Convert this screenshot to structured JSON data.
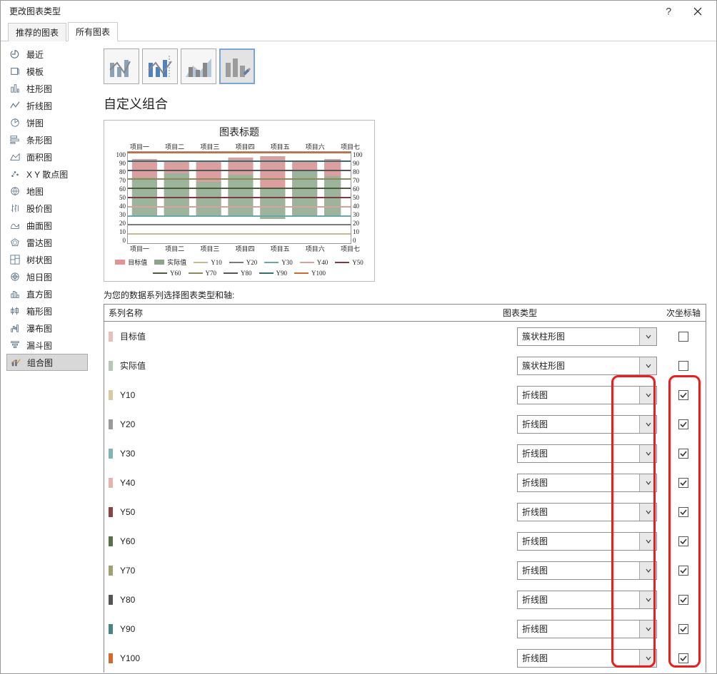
{
  "dialog": {
    "title": "更改图表类型"
  },
  "tabs": {
    "recommended": "推荐的图表",
    "all": "所有图表"
  },
  "categories": [
    {
      "icon": "recent",
      "label": "最近"
    },
    {
      "icon": "template",
      "label": "模板"
    },
    {
      "icon": "column",
      "label": "柱形图"
    },
    {
      "icon": "line",
      "label": "折线图"
    },
    {
      "icon": "pie",
      "label": "饼图"
    },
    {
      "icon": "bar",
      "label": "条形图"
    },
    {
      "icon": "area",
      "label": "面积图"
    },
    {
      "icon": "scatter",
      "label": "X Y 散点图"
    },
    {
      "icon": "map",
      "label": "地图"
    },
    {
      "icon": "stock",
      "label": "股价图"
    },
    {
      "icon": "surface",
      "label": "曲面图"
    },
    {
      "icon": "radar",
      "label": "雷达图"
    },
    {
      "icon": "treemap",
      "label": "树状图"
    },
    {
      "icon": "sunburst",
      "label": "旭日图"
    },
    {
      "icon": "histogram",
      "label": "直方图"
    },
    {
      "icon": "boxplot",
      "label": "箱形图"
    },
    {
      "icon": "waterfall",
      "label": "瀑布图"
    },
    {
      "icon": "funnel",
      "label": "漏斗图"
    },
    {
      "icon": "combo",
      "label": "组合图",
      "active": true
    }
  ],
  "section_title": "自定义组合",
  "chart_preview": {
    "title": "图表标题",
    "top_labels": [
      "项目一",
      "项目二",
      "项目三",
      "项目四",
      "项目五",
      "项目六",
      "项目七"
    ],
    "bottom_labels": [
      "项目一",
      "项目二",
      "项目三",
      "项目四",
      "项目五",
      "项目六",
      "项目七"
    ],
    "y_ticks_left": [
      100,
      90,
      80,
      70,
      60,
      50,
      40,
      30,
      20,
      10,
      0
    ],
    "y_ticks_right": [
      100,
      90,
      80,
      70,
      60,
      50,
      40,
      30,
      20,
      10,
      0
    ],
    "legend": [
      {
        "name": "目标值",
        "type": "area",
        "color": "#e49393"
      },
      {
        "name": "实际值",
        "type": "area",
        "color": "#8aa58a"
      },
      {
        "name": "Y10",
        "type": "line",
        "color": "#c7b991"
      },
      {
        "name": "Y20",
        "type": "line",
        "color": "#7a7a7a"
      },
      {
        "name": "Y30",
        "type": "line",
        "color": "#6aa7a7"
      },
      {
        "name": "Y40",
        "type": "line",
        "color": "#d8a29c"
      },
      {
        "name": "Y50",
        "type": "line",
        "color": "#7a3c3c"
      },
      {
        "name": "Y60",
        "type": "line",
        "color": "#4d5d3e"
      },
      {
        "name": "Y70",
        "type": "line",
        "color": "#8a8a5a"
      },
      {
        "name": "Y80",
        "type": "line",
        "color": "#555"
      },
      {
        "name": "Y90",
        "type": "line",
        "color": "#3a6d6d"
      },
      {
        "name": "Y100",
        "type": "line",
        "color": "#d06a32"
      }
    ]
  },
  "series_picker": {
    "label": "为您的数据系列选择图表类型和轴:",
    "col_name": "系列名称",
    "col_type": "图表类型",
    "col_axis": "次坐标轴",
    "option_column": "簇状柱形图",
    "option_line": "折线图",
    "series": [
      {
        "color": "#e8bebe",
        "name": "目标值",
        "type": "簇状柱形图",
        "secondary": false
      },
      {
        "color": "#b4c8b4",
        "name": "实际值",
        "type": "簇状柱形图",
        "secondary": false
      },
      {
        "color": "#d9c9a3",
        "name": "Y10",
        "type": "折线图",
        "secondary": true
      },
      {
        "color": "#9a9a9a",
        "name": "Y20",
        "type": "折线图",
        "secondary": true
      },
      {
        "color": "#7fb5b5",
        "name": "Y30",
        "type": "折线图",
        "secondary": true
      },
      {
        "color": "#e4b4ac",
        "name": "Y40",
        "type": "折线图",
        "secondary": true
      },
      {
        "color": "#8a4444",
        "name": "Y50",
        "type": "折线图",
        "secondary": true
      },
      {
        "color": "#5a6e4a",
        "name": "Y60",
        "type": "折线图",
        "secondary": true
      },
      {
        "color": "#a0a070",
        "name": "Y70",
        "type": "折线图",
        "secondary": true
      },
      {
        "color": "#555555",
        "name": "Y80",
        "type": "折线图",
        "secondary": true
      },
      {
        "color": "#4a8585",
        "name": "Y90",
        "type": "折线图",
        "secondary": true
      },
      {
        "color": "#d06a32",
        "name": "Y100",
        "type": "折线图",
        "secondary": true
      }
    ]
  }
}
